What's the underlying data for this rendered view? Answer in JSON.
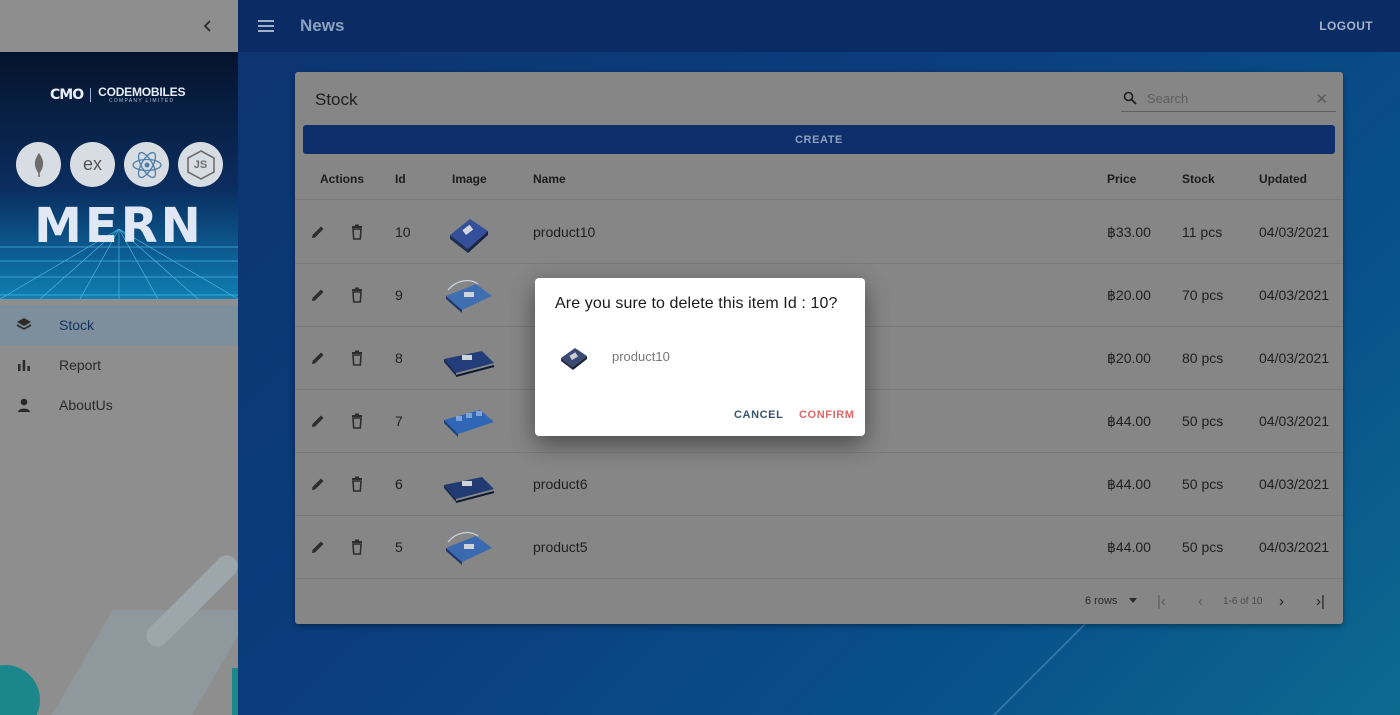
{
  "appbar": {
    "title": "News",
    "logout_label": "LOGOUT",
    "menu_icon": "menu-icon"
  },
  "sidebar": {
    "collapse_icon": "chevron-left-icon",
    "brand": {
      "mark": "CMO",
      "name": "CODEMOBILES",
      "sub": "COMPANY LIMITED"
    },
    "tech_icons": [
      "mongodb-icon",
      "express-icon",
      "react-icon",
      "nodejs-icon"
    ],
    "tech_labels": {
      "express": "ex",
      "node": "JS"
    },
    "banner_title": "MERN",
    "items": [
      {
        "label": "Stock",
        "icon": "layers-icon",
        "active": true
      },
      {
        "label": "Report",
        "icon": "bar-chart-icon",
        "active": false
      },
      {
        "label": "AboutUs",
        "icon": "person-icon",
        "active": false
      }
    ]
  },
  "card": {
    "title": "Stock",
    "search_placeholder": "Search",
    "create_label": "CREATE",
    "columns": {
      "actions": "Actions",
      "id": "Id",
      "image": "Image",
      "name": "Name",
      "price": "Price",
      "stock": "Stock",
      "updated": "Updated"
    },
    "rows": [
      {
        "id": "10",
        "name": "product10",
        "price": "฿33.00",
        "stock": "11 pcs",
        "updated": "04/03/2021"
      },
      {
        "id": "9",
        "name": "",
        "price": "฿20.00",
        "stock": "70 pcs",
        "updated": "04/03/2021"
      },
      {
        "id": "8",
        "name": "",
        "price": "฿20.00",
        "stock": "80 pcs",
        "updated": "04/03/2021"
      },
      {
        "id": "7",
        "name": "",
        "price": "฿44.00",
        "stock": "50 pcs",
        "updated": "04/03/2021"
      },
      {
        "id": "6",
        "name": "product6",
        "price": "฿44.00",
        "stock": "50 pcs",
        "updated": "04/03/2021"
      },
      {
        "id": "5",
        "name": "product5",
        "price": "฿44.00",
        "stock": "50 pcs",
        "updated": "04/03/2021"
      }
    ],
    "pagination": {
      "rows_per_page": "6 rows",
      "range": "1-6 of 10"
    }
  },
  "dialog": {
    "title": "Are you sure to delete this item Id : 10?",
    "product_name": "product10",
    "cancel_label": "CANCEL",
    "confirm_label": "CONFIRM"
  },
  "colors": {
    "appbar": "#0a2b63",
    "create_button": "#0e2f6b",
    "confirm_text": "#e06767",
    "cancel_text": "#39556e"
  }
}
